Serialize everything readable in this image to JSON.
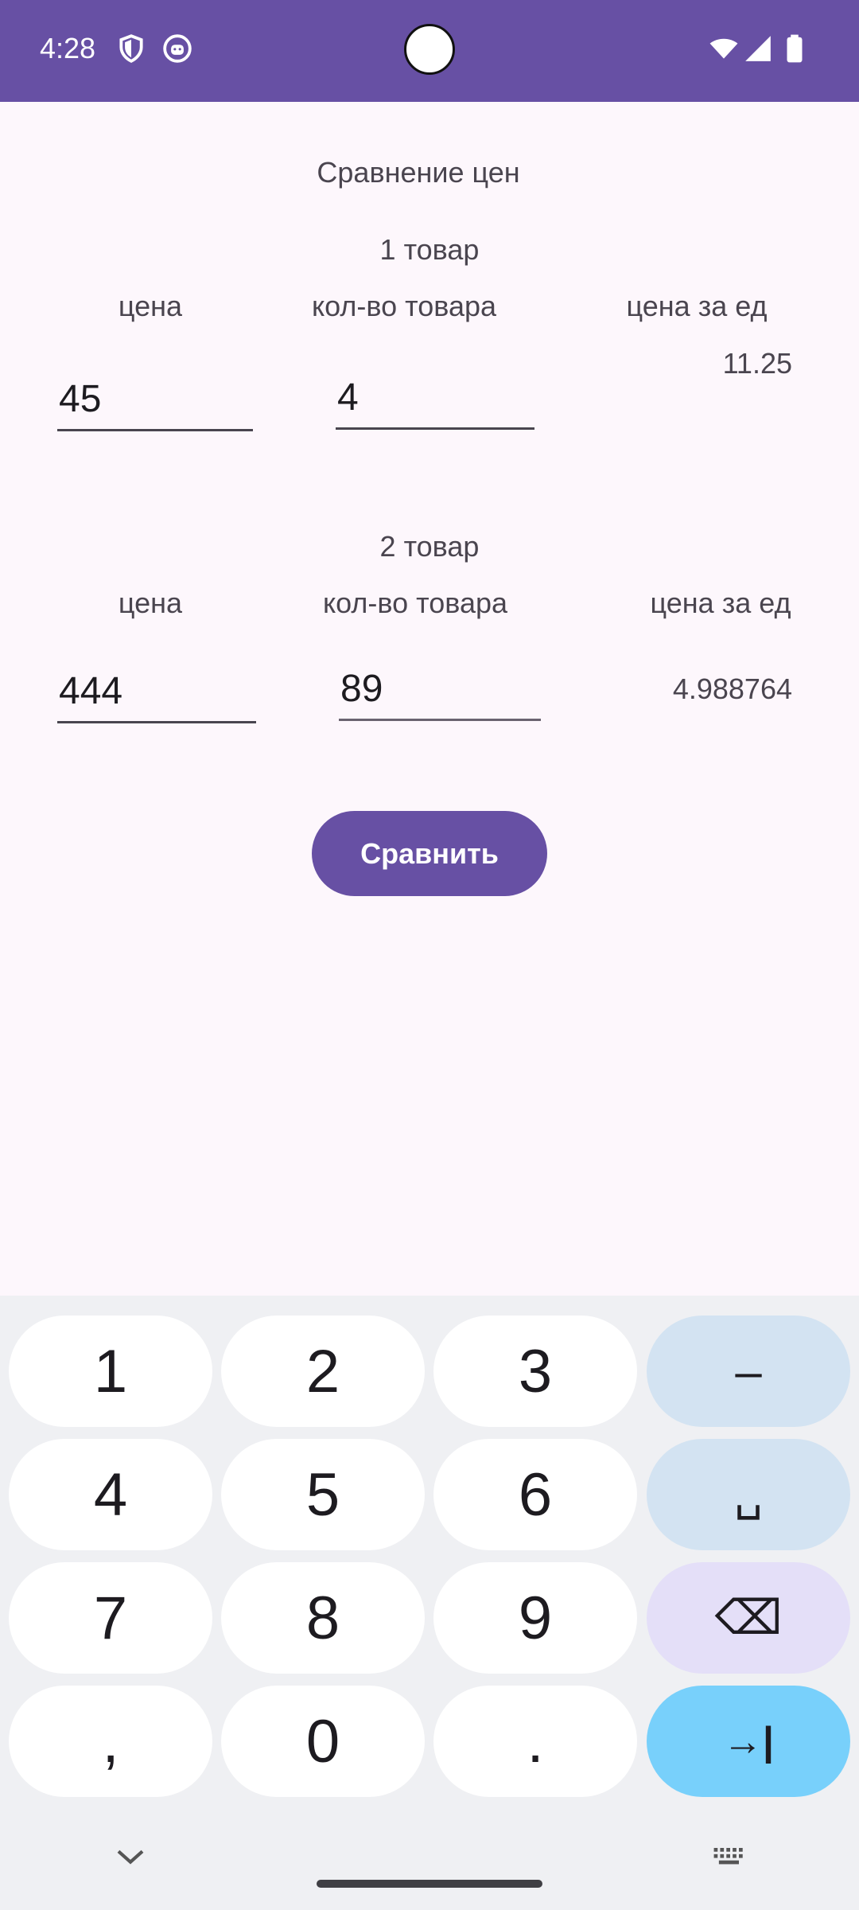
{
  "status_bar": {
    "time": "4:28"
  },
  "app": {
    "title": "Сравнение цен",
    "item1": {
      "heading": "1 товар",
      "price_label": "цена",
      "qty_label": "кол-во товара",
      "unit_price_label": "цена за ед",
      "price_value": "45",
      "qty_value": "4",
      "unit_price_result": "11.25"
    },
    "item2": {
      "heading": "2 товар",
      "price_label": "цена",
      "qty_label": "кол-во товара",
      "unit_price_label": "цена за ед",
      "price_value": "444",
      "qty_value": "89",
      "unit_price_result": "4.988764"
    },
    "compare_button": "Сравнить"
  },
  "keyboard": {
    "keys": [
      "1",
      "2",
      "3",
      "–",
      "4",
      "5",
      "6",
      "␣",
      "7",
      "8",
      "9",
      "⌫",
      ",",
      "0",
      ".",
      "→|"
    ]
  },
  "colors": {
    "primary": "#6750a4",
    "background": "#fdf7fc",
    "keyboard_bg": "#eff0f3",
    "enter_key": "#78d0fb"
  }
}
